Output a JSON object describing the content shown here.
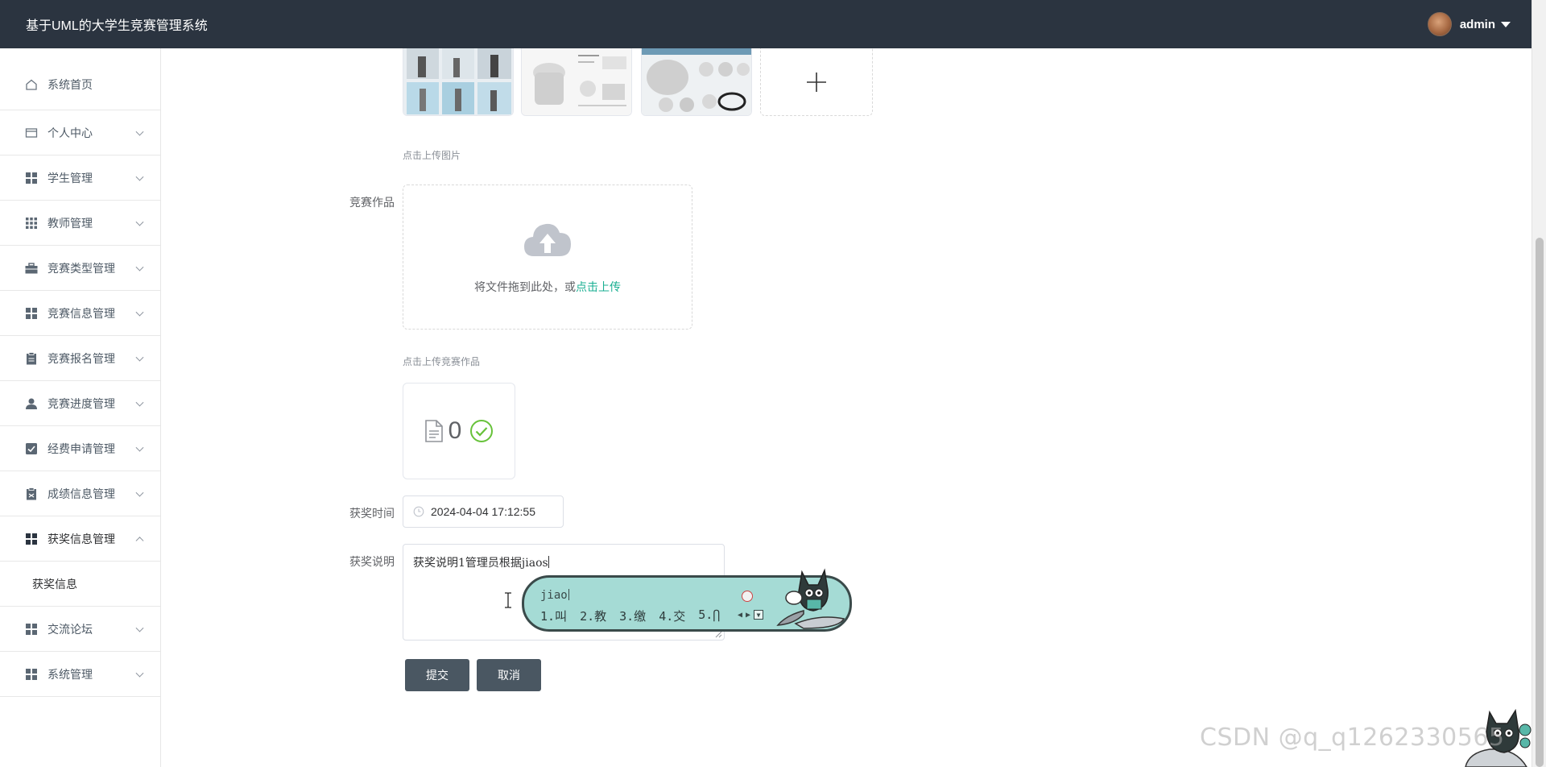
{
  "header": {
    "title": "基于UML的大学生竞赛管理系统",
    "username": "admin"
  },
  "sidebar": {
    "items": [
      {
        "label": "系统首页",
        "icon": "home-icon"
      },
      {
        "label": "个人中心",
        "icon": "card-icon"
      },
      {
        "label": "学生管理",
        "icon": "grid-icon"
      },
      {
        "label": "教师管理",
        "icon": "apps-icon"
      },
      {
        "label": "竞赛类型管理",
        "icon": "briefcase-icon"
      },
      {
        "label": "竞赛信息管理",
        "icon": "grid-icon"
      },
      {
        "label": "竞赛报名管理",
        "icon": "clipboard-icon"
      },
      {
        "label": "竞赛进度管理",
        "icon": "user-icon"
      },
      {
        "label": "经费申请管理",
        "icon": "checkbox-icon"
      },
      {
        "label": "成绩信息管理",
        "icon": "document-icon"
      },
      {
        "label": "获奖信息管理",
        "icon": "grid-icon"
      },
      {
        "label": "交流论坛",
        "icon": "grid-icon"
      },
      {
        "label": "系统管理",
        "icon": "grid-icon"
      }
    ],
    "submenu": {
      "label": "获奖信息"
    }
  },
  "form": {
    "images_hint": "点击上传图片",
    "work_label": "竞赛作品",
    "dropzone_text": "将文件拖到此处，或",
    "dropzone_link": "点击上传",
    "work_hint": "点击上传竞赛作品",
    "file_count": "0",
    "award_time_label": "获奖时间",
    "award_time_value": "2024-04-04 17:12:55",
    "award_desc_label": "获奖说明",
    "award_desc_value": "获奖说明1管理员根据jiaos",
    "submit_label": "提交",
    "cancel_label": "取消"
  },
  "ime": {
    "composition": "jiao",
    "candidates": [
      "1.叫",
      "2.教",
      "3.缴",
      "4.交",
      "5.⋂"
    ]
  },
  "watermark": "CSDN @q_q1262330565",
  "colors": {
    "header_bg": "#2b3440",
    "link_accent": "#1aaf92",
    "button_bg": "#4a5762",
    "success_green": "#67c23a",
    "ime_bg": "#a5dbd5"
  }
}
